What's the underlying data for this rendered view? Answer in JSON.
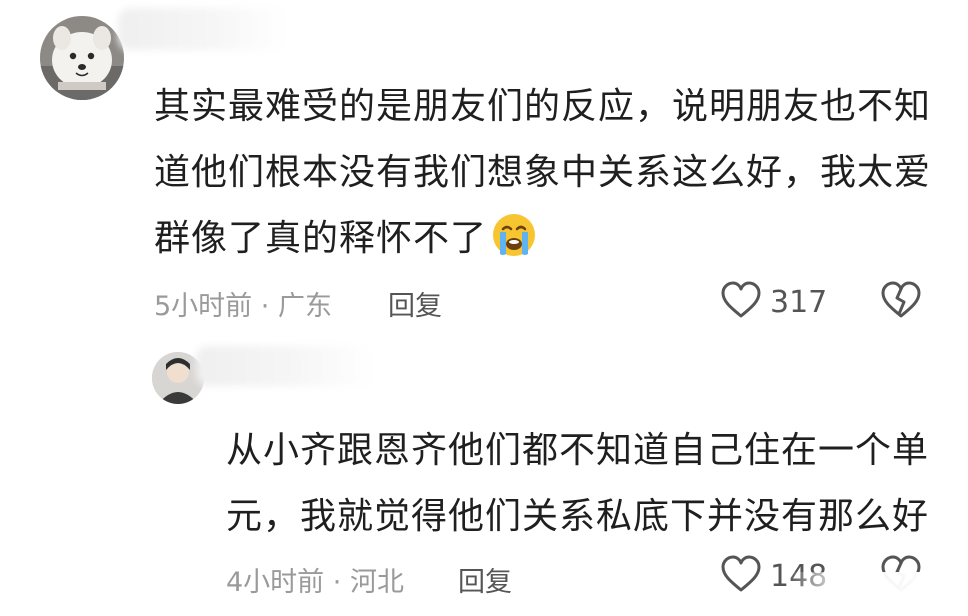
{
  "comments": [
    {
      "text_lines": [
        "其实最难受的是朋友们的反应，说明朋友也不知",
        "道他们根本没有我们想象中关系这么好，我太爱",
        "群像了真的释怀不了"
      ],
      "emoji": "loudly-crying-face",
      "time": "5小时前",
      "location": "广东",
      "meta_separator": "·",
      "reply_label": "回复",
      "likes": "317"
    },
    {
      "text_lines": [
        "从小齐跟恩齐他们都不知道自己住在一个单",
        "元，我就觉得他们关系私底下并没有那么好"
      ],
      "time": "4小时前",
      "location": "河北",
      "meta_separator": "·",
      "reply_label": "回复",
      "likes": "148"
    }
  ],
  "icons": {
    "like": "heart-outline-icon",
    "dislike": "broken-heart-outline-icon"
  },
  "colors": {
    "text": "#1f1f1f",
    "meta": "#9a9a9a",
    "action": "#555555",
    "background": "#ffffff"
  }
}
